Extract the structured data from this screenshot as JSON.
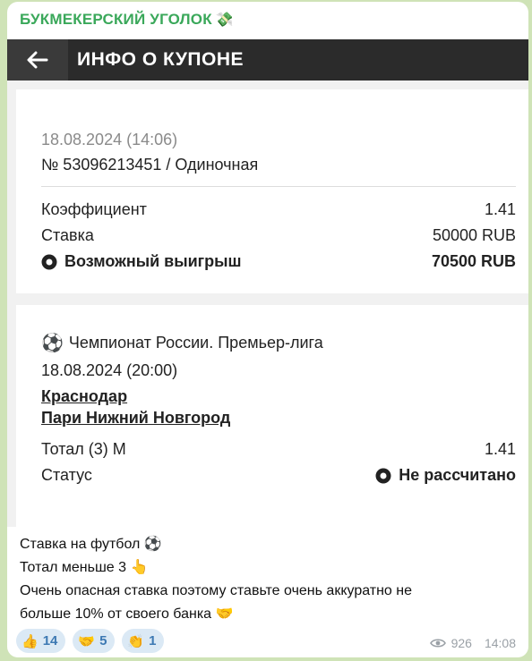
{
  "channel": {
    "name": "БУКМЕКЕРСКИЙ УГОЛОК",
    "emoji": "💸"
  },
  "coupon_screen": {
    "title": "ИНФО О КУПОНЕ",
    "summary": {
      "datetime": "18.08.2024 (14:06)",
      "coupon": "№ 53096213451 / Одиночная",
      "rows": [
        {
          "label": "Коэффициент",
          "value": "1.41"
        },
        {
          "label": "Ставка",
          "value": "50000 RUB"
        },
        {
          "label": "Возможный выигрыш",
          "value": "70500 RUB"
        }
      ]
    },
    "event": {
      "sport_icon": "⚽",
      "league": "Чемпионат России. Премьер-лига",
      "datetime": "18.08.2024 (20:00)",
      "team1": "Краснодар",
      "team2": "Пари Нижний Новгород",
      "market_label": "Тотал (3) М",
      "market_value": "1.41",
      "status_label": "Статус",
      "status_value": "Не рассчитано"
    }
  },
  "caption": {
    "line1": "Ставка на футбол ⚽",
    "line2": "Тотал меньше 3 👆",
    "line3": "Очень опасная ставка поэтому ставьте очень аккуратно не",
    "line4": "больше 10% от своего банка 🤝"
  },
  "reactions": [
    {
      "emoji": "👍",
      "count": "14"
    },
    {
      "emoji": "🤝",
      "count": "5"
    },
    {
      "emoji": "👏",
      "count": "1"
    }
  ],
  "meta": {
    "views": "926",
    "time": "14:08"
  }
}
